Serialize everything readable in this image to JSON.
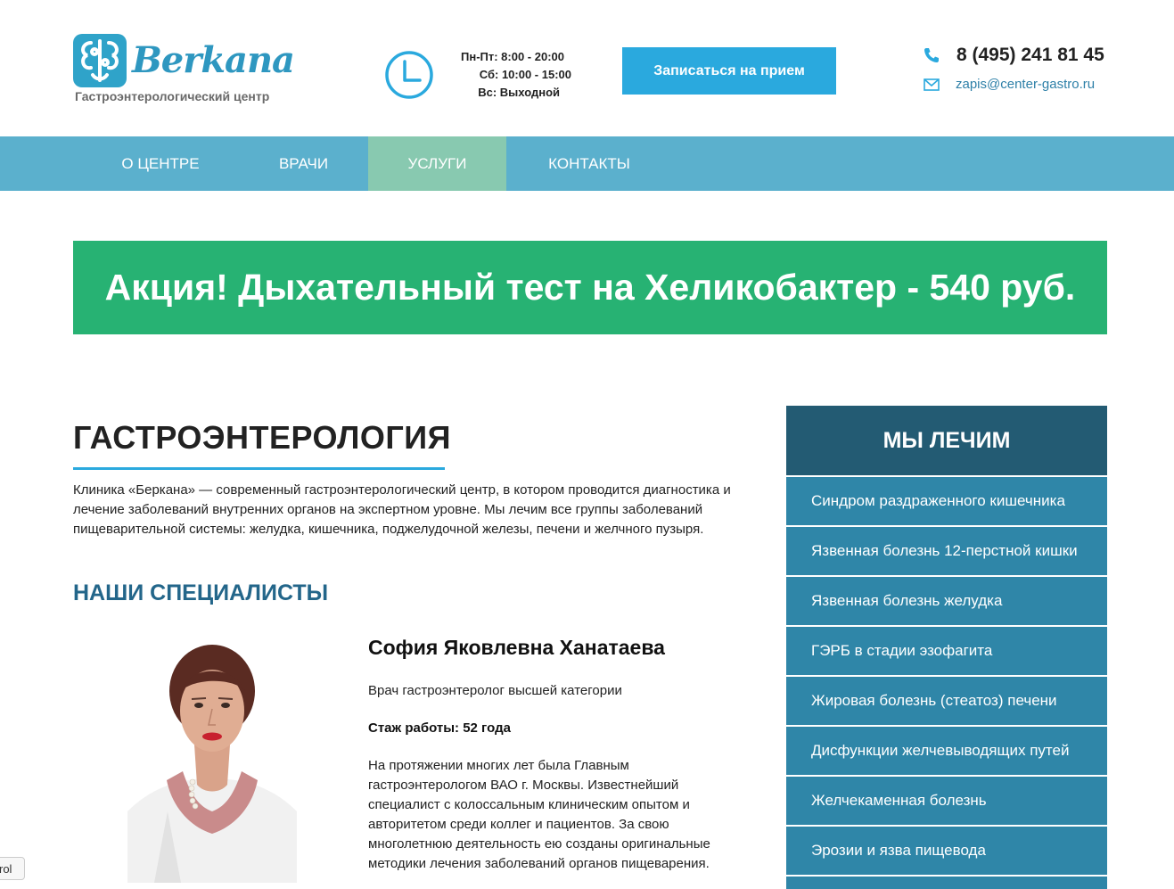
{
  "header": {
    "logo_text": "Berkana",
    "logo_subtitle": "Гастроэнтерологический центр",
    "hours": [
      "Пн-Пт: 8:00 - 20:00",
      "Сб: 10:00 - 15:00",
      "Вс: Выходной"
    ],
    "cta_label": "Записаться на прием",
    "phone": "8 (495) 241 81 45",
    "email": "zapis@center-gastro.ru"
  },
  "nav": {
    "items": [
      {
        "label": "О ЦЕНТРЕ",
        "active": false
      },
      {
        "label": "ВРАЧИ",
        "active": false
      },
      {
        "label": "УСЛУГИ",
        "active": true
      },
      {
        "label": "КОНТАКТЫ",
        "active": false
      }
    ]
  },
  "promo": {
    "text": "Акция! Дыхательный тест на Хеликобактер - 540 руб."
  },
  "main": {
    "title": "ГАСТРОЭНТЕРОЛОГИЯ",
    "intro": "Клиника «Беркана» — современный гастроэнтерологический центр, в котором проводится диагностика и лечение заболеваний внутренних органов на экспертном уровне. Мы лечим все группы заболеваний пищеварительной системы: желудка, кишечника, поджелудочной железы, печени и желчного пузыря.",
    "specialists_heading": "НАШИ СПЕЦИАЛИСТЫ",
    "doctor": {
      "name": "София Яковлевна Ханатаева",
      "role": "Врач гастроэнтеролог высшей категории",
      "experience": "Стаж работы: 52 года",
      "description": "На протяжении многих лет была Главным гастроэнтерологом ВАО г. Москвы. Известнейший специалист с колоссальным клиническим опытом и авторитетом среди коллег и пациентов. За свою многолетнюю деятельность ею созданы оригинальные методики лечения заболеваний органов пищеварения."
    }
  },
  "sidebar": {
    "heading": "МЫ ЛЕЧИМ",
    "items": [
      {
        "label": "Синдром раздраженного кишечника"
      },
      {
        "label": "Язвенная болезнь 12-перстной кишки"
      },
      {
        "label": "Язвенная болезнь желудка"
      },
      {
        "label": "ГЭРБ в стадии эзофагита"
      },
      {
        "label": "Жировая болезнь (стеатоз) печени"
      },
      {
        "label": "Дисфункции желчевыводящих путей"
      },
      {
        "label": "Желчекаменная болезнь"
      },
      {
        "label": "Эрозии и язва пищевода"
      }
    ]
  },
  "widget": {
    "label": "rol"
  },
  "colors": {
    "accent": "#2aa9de",
    "nav": "#5bb0cd",
    "nav_active": "#88c9b0",
    "promo": "#27b273",
    "sidebar_head": "#235b73",
    "sidebar_item": "#2f86a8",
    "heading_blue": "#23668a"
  }
}
